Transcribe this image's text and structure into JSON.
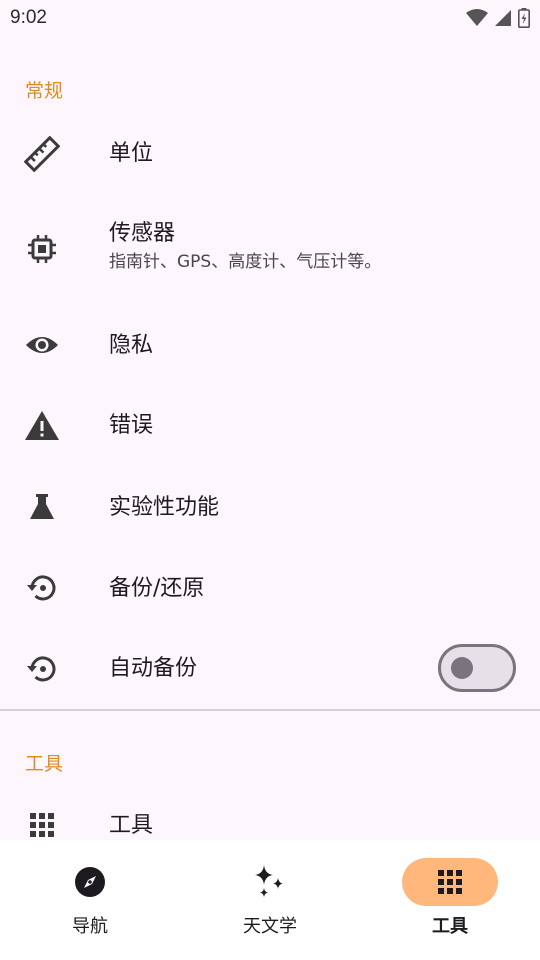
{
  "status_bar": {
    "time": "9:02"
  },
  "sections": {
    "general": {
      "header": "常规"
    },
    "tools": {
      "header": "工具"
    }
  },
  "items": {
    "units": {
      "title": "单位"
    },
    "sensors": {
      "title": "传感器",
      "subtitle": "指南针、GPS、高度计、气压计等。"
    },
    "privacy": {
      "title": "隐私"
    },
    "errors": {
      "title": "错误"
    },
    "experimental": {
      "title": "实验性功能"
    },
    "backup_restore": {
      "title": "备份/还原"
    },
    "auto_backup": {
      "title": "自动备份",
      "toggle_on": false
    },
    "tools": {
      "title": "工具"
    }
  },
  "bottom_nav": {
    "items": [
      {
        "label": "导航",
        "icon": "compass-icon",
        "active": false
      },
      {
        "label": "天文学",
        "icon": "sparkles-icon",
        "active": false
      },
      {
        "label": "工具",
        "icon": "grid-icon",
        "active": true
      }
    ]
  },
  "colors": {
    "accent": "#e38a1f",
    "active_pill": "#ffb77c",
    "background": "#fdf7fd"
  }
}
